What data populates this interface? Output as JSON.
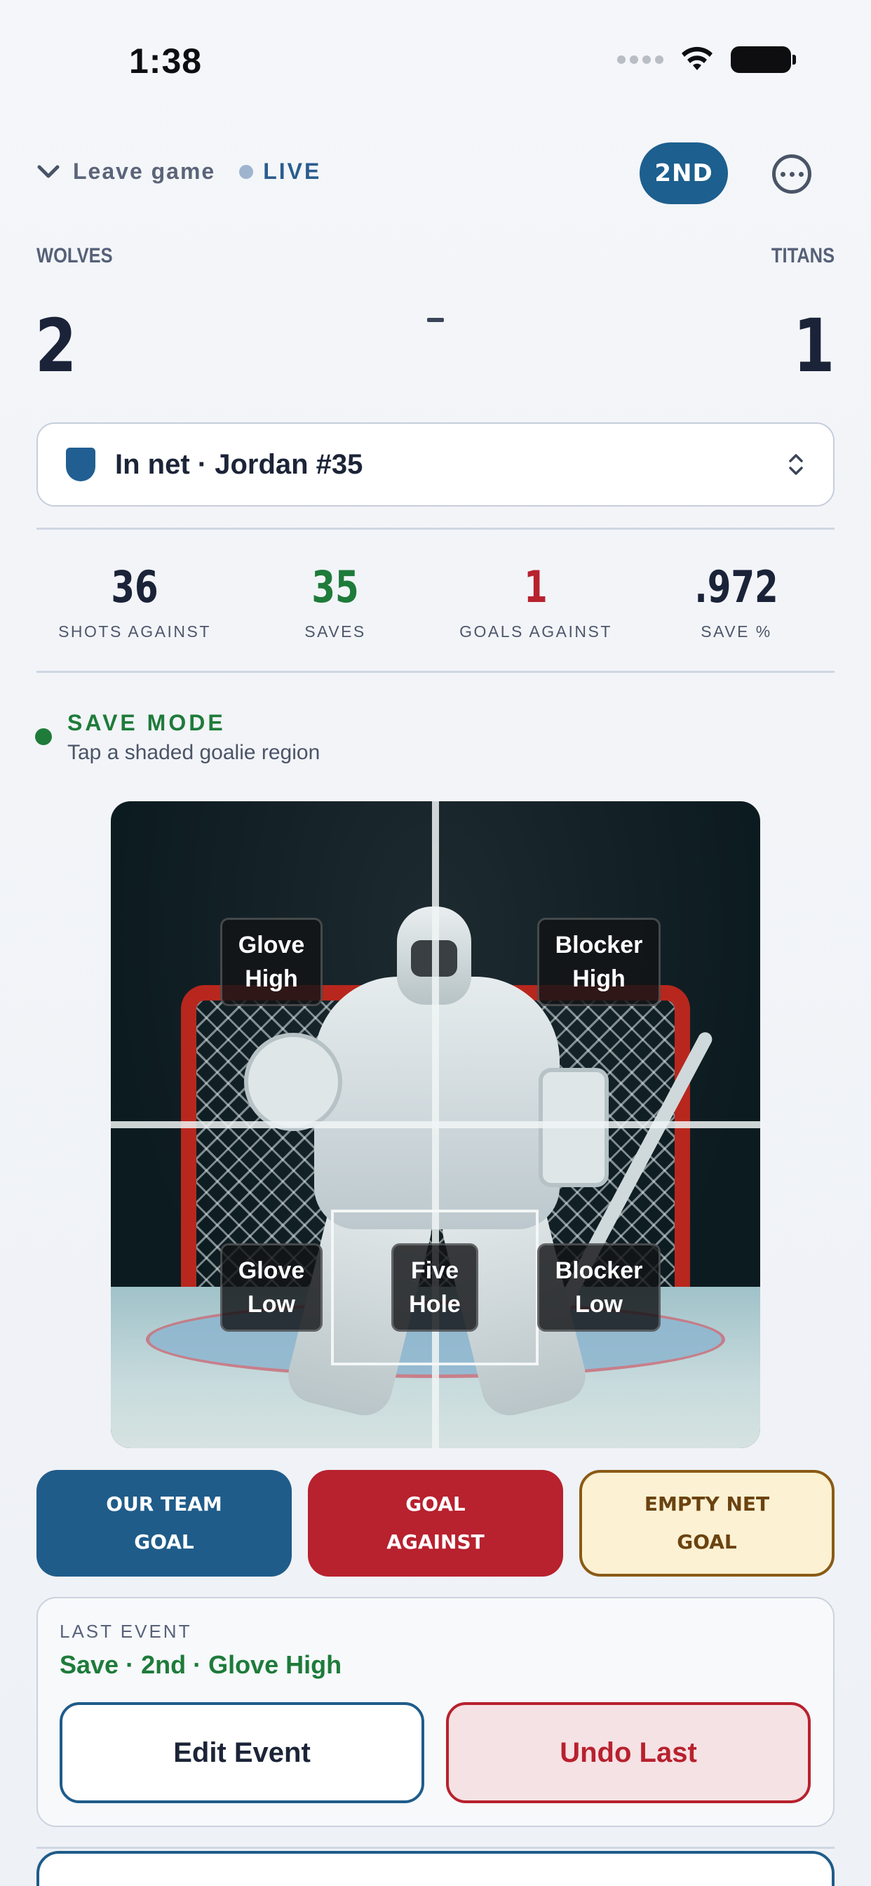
{
  "status_bar": {
    "time": "1:38"
  },
  "header": {
    "leave_label": "Leave game",
    "live_label": "LIVE",
    "period": "2ND"
  },
  "scoreboard": {
    "home_team": "WOLVES",
    "away_team": "TITANS",
    "home_score": "2",
    "away_score": "1"
  },
  "goalie_select": {
    "label": "In net · Jordan #35"
  },
  "stats": [
    {
      "value": "36",
      "label": "SHOTS AGAINST",
      "color": "#1b2339"
    },
    {
      "value": "35",
      "label": "SAVES",
      "color": "#1e7b3a"
    },
    {
      "value": "1",
      "label": "GOALS AGAINST",
      "color": "#b8212e"
    },
    {
      "value": ".972",
      "label": "SAVE %",
      "color": "#1b2339"
    }
  ],
  "mode": {
    "title": "SAVE MODE",
    "subtitle": "Tap a shaded goalie region"
  },
  "zones": {
    "glove_high": "Glove\nHigh",
    "blocker_high": "Blocker\nHigh",
    "glove_low": "Glove\nLow",
    "five_hole": "Five\nHole",
    "blocker_low": "Blocker\nLow"
  },
  "actions": {
    "our_goal": "OUR TEAM\nGOAL",
    "goal_against": "GOAL\nAGAINST",
    "empty_net": "EMPTY NET\nGOAL"
  },
  "last_event": {
    "kicker": "LAST EVENT",
    "text": "Save · 2nd · Glove High",
    "edit_label": "Edit Event",
    "undo_label": "Undo Last"
  },
  "colors": {
    "accent_blue": "#1f5c8a",
    "danger_red": "#b8212e",
    "success_green": "#1e7b3a"
  }
}
